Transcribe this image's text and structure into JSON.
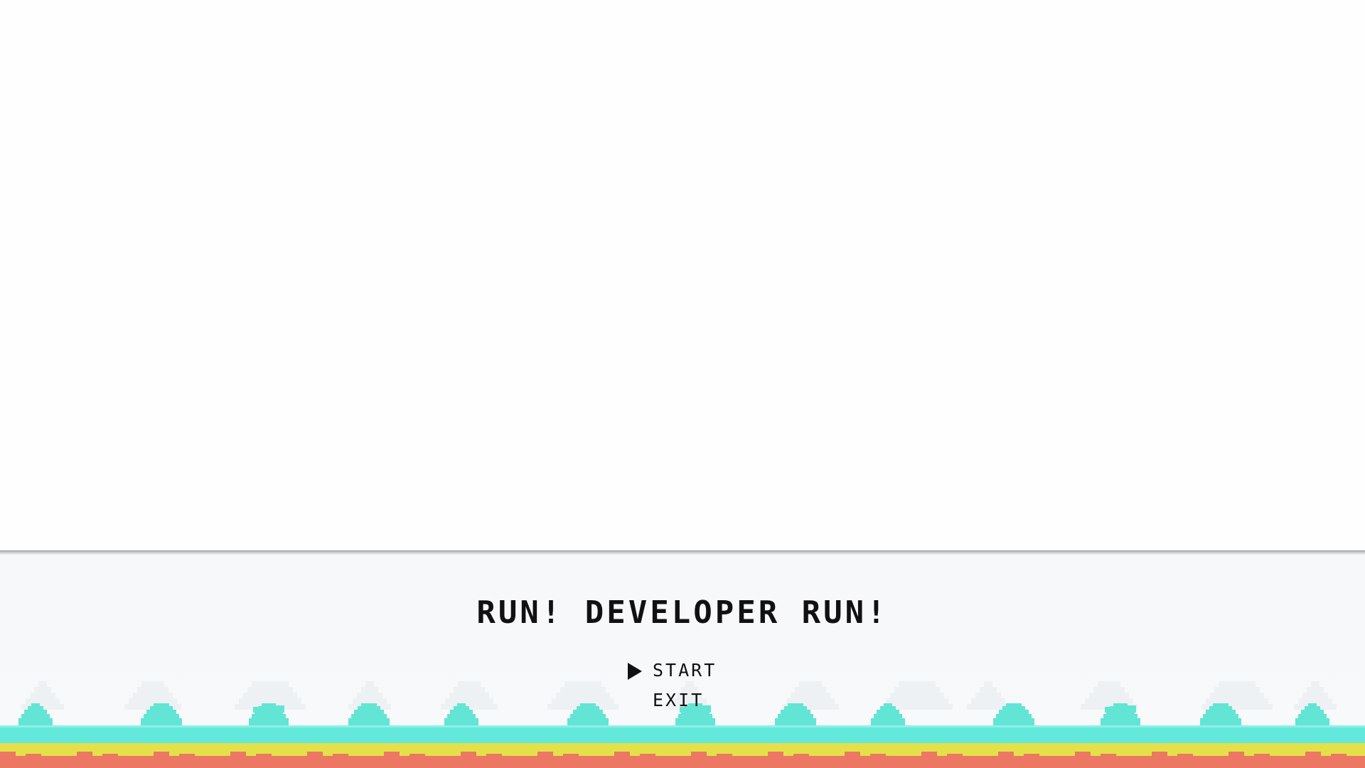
{
  "game": {
    "title": "RUN! DEVELOPER RUN!",
    "menu": {
      "items": [
        {
          "label": "START",
          "selected": true
        },
        {
          "label": "EXIT",
          "selected": false
        }
      ]
    },
    "colors": {
      "background": "#fefefe",
      "panel": "#f6f8fa",
      "bush": "#62e5d5",
      "ground_top": "#62e9dc",
      "ground_mid": "#e4e04a",
      "ground_bottom": "#ec7762",
      "text": "#111111"
    },
    "icons": {
      "cursor": "triangle-right"
    }
  }
}
